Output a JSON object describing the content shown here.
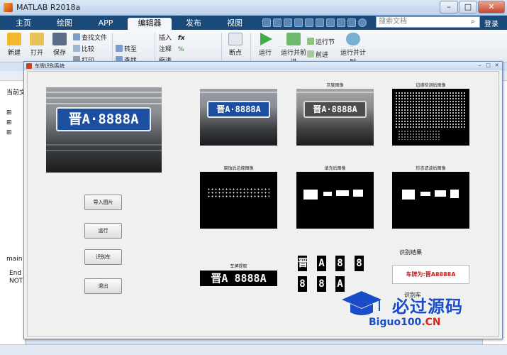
{
  "app": {
    "title": "MATLAB R2018a",
    "window_controls": [
      "–",
      "□",
      "✕"
    ]
  },
  "tabs": [
    "主页",
    "绘图",
    "APP",
    "编辑器",
    "发布",
    "视图"
  ],
  "active_tab": "编辑器",
  "search": {
    "placeholder": "搜索文档"
  },
  "login_label": "登录",
  "ribbon": {
    "new_label": "新建",
    "open_label": "打开",
    "save_label": "保存",
    "find_files_label": "查找文件",
    "compare_label": "比较",
    "print_label": "打印",
    "goto_label": "转至",
    "find_label": "查找",
    "insert_label": "插入",
    "comment_label": "注释",
    "indent_label": "缩进",
    "breakpoint_label": "断点",
    "run_label": "运行",
    "run_advance_label": "运行并前进",
    "run_section_label": "运行节",
    "advance_label": "前进",
    "run_time_label": "运行并计时"
  },
  "background": {
    "current_folder_label": "当前文",
    "workspace_label": "main",
    "cmd_lines": [
      "End",
      "NOT"
    ]
  },
  "figure": {
    "title": "车牌识别系统",
    "plate_text": "晋A·8888A",
    "axes_titles": {
      "gray": "灰度图像",
      "edge": "边缘检测后图像",
      "erode": "腐蚀后边缘图像",
      "fill": "填充后图像",
      "morph": "形态滤波后图像",
      "extract": "车牌提取"
    },
    "extracted_plate_text": "晋A 8888A",
    "segmented_chars": [
      "晋",
      "A",
      "8",
      "8",
      "8",
      "8",
      "A"
    ],
    "buttons": {
      "import": "导入图片",
      "run": "运行",
      "recognize": "识别车",
      "exit": "退出"
    },
    "result_label": "识别结果",
    "result_text": "车牌为:晋A8888A",
    "result_label2": "识别车"
  },
  "watermark": {
    "text": "必过源码",
    "url_main": "Biguo100",
    "url_suffix": ".CN"
  },
  "colors": {
    "tabbar": "#1a4a79",
    "plate_blue": "#1c4fa0",
    "result_red": "#d11a1a",
    "watermark_blue": "#1a4cc9"
  }
}
